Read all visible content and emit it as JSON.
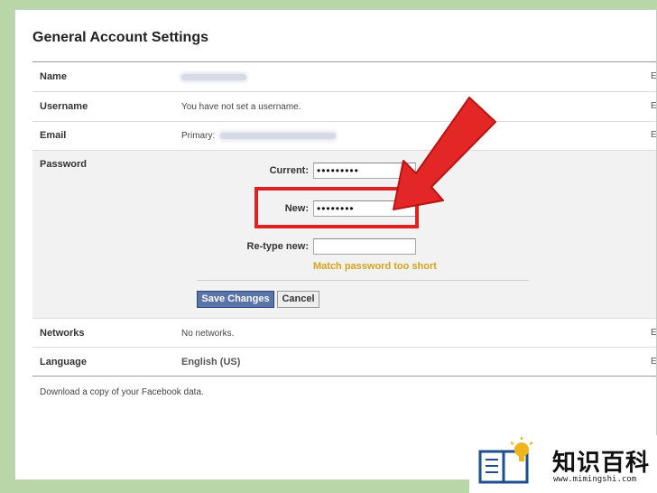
{
  "page": {
    "title": "General Account Settings",
    "footer_text": "Download a copy of your Facebook data."
  },
  "rows": {
    "name": {
      "label": "Name"
    },
    "username": {
      "label": "Username",
      "value": "You have not set a username."
    },
    "email": {
      "label": "Email",
      "value_prefix": "Primary:"
    },
    "password": {
      "label": "Password"
    },
    "networks": {
      "label": "Networks",
      "value": "No networks."
    },
    "language": {
      "label": "Language",
      "value": "English (US)"
    },
    "edit_edge": "E"
  },
  "password_form": {
    "current_label": "Current:",
    "current_value": "•••••••••",
    "new_label": "New:",
    "new_value": "••••••••",
    "retype_label": "Re-type new:",
    "retype_value": "",
    "hint": "Match password too short",
    "save_label": "Save Changes",
    "cancel_label": "Cancel"
  },
  "colors": {
    "highlight": "#e02121",
    "hint": "#d7a21c",
    "primary_button": "#5b74a8",
    "background": "#b9d6a8"
  },
  "watermark": {
    "icon": "book-lightbulb-icon",
    "text": "知识百科",
    "url": "www.mimingshi.com"
  }
}
